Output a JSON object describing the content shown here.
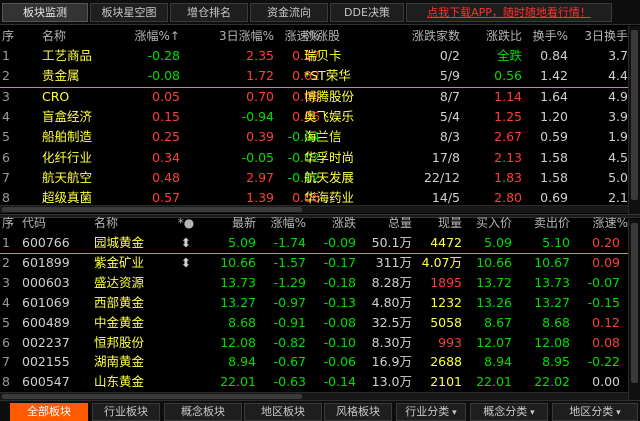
{
  "colors": {
    "up": "#ff3c3c",
    "down": "#00dd00",
    "yellow": "#ffff40",
    "cyan": "#40e0ff",
    "neutral": "#d0d0d0",
    "accent": "#ff5a00"
  },
  "top_tabs": [
    "板块监测",
    "板块星空图",
    "增仓排名",
    "资金流向",
    "DDE决策"
  ],
  "promo": "点我下载APP，随时随地看行情！",
  "upper": {
    "headers": [
      "序",
      "名称",
      "涨幅%↑",
      "3日涨幅%",
      "涨速%",
      "领涨股",
      "涨跌家数",
      "涨跌比",
      "换手%",
      "3日换手"
    ],
    "rows": [
      {
        "idx": "1",
        "name": "工艺商品",
        "chg": "-0.28",
        "chg3": "2.35",
        "speed": "0.17",
        "leader": "瑞贝卡",
        "updown": "0/2",
        "ratio": "全跌",
        "turn": "0.84",
        "turn3": "3.7"
      },
      {
        "idx": "2",
        "name": "贵金属",
        "chg": "-0.08",
        "chg3": "1.72",
        "speed": "0.02",
        "leader": "*ST荣华",
        "updown": "5/9",
        "ratio": "0.56",
        "turn": "1.42",
        "turn3": "4.4"
      },
      {
        "idx": "3",
        "name": "CRO",
        "chg": "0.05",
        "chg3": "0.70",
        "speed": "0.08",
        "leader": "博腾股份",
        "updown": "8/7",
        "ratio": "1.14",
        "turn": "1.64",
        "turn3": "4.9"
      },
      {
        "idx": "4",
        "name": "盲盒经济",
        "chg": "0.15",
        "chg3": "-0.94",
        "speed": "0.06",
        "leader": "奥飞娱乐",
        "updown": "5/4",
        "ratio": "1.25",
        "turn": "1.20",
        "turn3": "3.9"
      },
      {
        "idx": "5",
        "name": "船舶制造",
        "chg": "0.25",
        "chg3": "0.39",
        "speed": "-0.04",
        "leader": "海兰信",
        "updown": "8/3",
        "ratio": "2.67",
        "turn": "0.59",
        "turn3": "1.9"
      },
      {
        "idx": "6",
        "name": "化纤行业",
        "chg": "0.34",
        "chg3": "-0.05",
        "speed": "-0.02",
        "leader": "华孚时尚",
        "updown": "17/8",
        "ratio": "2.13",
        "turn": "1.58",
        "turn3": "4.5"
      },
      {
        "idx": "7",
        "name": "航天航空",
        "chg": "0.48",
        "chg3": "2.97",
        "speed": "-0.02",
        "leader": "航天发展",
        "updown": "22/12",
        "ratio": "1.83",
        "turn": "1.58",
        "turn3": "5.0"
      },
      {
        "idx": "8",
        "name": "超级真菌",
        "chg": "0.57",
        "chg3": "1.39",
        "speed": "0.06",
        "leader": "华海药业",
        "updown": "14/5",
        "ratio": "2.80",
        "turn": "0.69",
        "turn3": "2.1"
      }
    ]
  },
  "lower": {
    "headers": [
      "序",
      "代码",
      "名称",
      "*●",
      "最新",
      "涨幅%",
      "涨跌",
      "总量",
      "现量",
      "买入价",
      "卖出价",
      "涨速%"
    ],
    "rows": [
      {
        "idx": "1",
        "code": "600766",
        "name": "园城黄金",
        "mark": "⬍",
        "price": "5.09",
        "chg": "-1.74",
        "diff": "-0.09",
        "vol": "50.1万",
        "now": "4472",
        "buy": "5.09",
        "sell": "5.10",
        "speed": "0.20"
      },
      {
        "idx": "2",
        "code": "601899",
        "name": "紫金矿业",
        "mark": "⬍",
        "price": "10.66",
        "chg": "-1.57",
        "diff": "-0.17",
        "vol": "311万",
        "now": "4.07万",
        "buy": "10.66",
        "sell": "10.67",
        "speed": "0.09"
      },
      {
        "idx": "3",
        "code": "000603",
        "name": "盛达资源",
        "mark": "",
        "price": "13.73",
        "chg": "-1.29",
        "diff": "-0.18",
        "vol": "8.28万",
        "now": "1895",
        "buy": "13.72",
        "sell": "13.73",
        "speed": "-0.07"
      },
      {
        "idx": "4",
        "code": "601069",
        "name": "西部黄金",
        "mark": "",
        "price": "13.27",
        "chg": "-0.97",
        "diff": "-0.13",
        "vol": "4.80万",
        "now": "1232",
        "buy": "13.26",
        "sell": "13.27",
        "speed": "-0.15"
      },
      {
        "idx": "5",
        "code": "600489",
        "name": "中金黄金",
        "mark": "",
        "price": "8.68",
        "chg": "-0.91",
        "diff": "-0.08",
        "vol": "32.5万",
        "now": "5058",
        "buy": "8.67",
        "sell": "8.68",
        "speed": "0.12"
      },
      {
        "idx": "6",
        "code": "002237",
        "name": "恒邦股份",
        "mark": "",
        "price": "12.08",
        "chg": "-0.82",
        "diff": "-0.10",
        "vol": "8.30万",
        "now": "993",
        "buy": "12.07",
        "sell": "12.08",
        "speed": "0.08"
      },
      {
        "idx": "7",
        "code": "002155",
        "name": "湖南黄金",
        "mark": "",
        "price": "8.94",
        "chg": "-0.67",
        "diff": "-0.06",
        "vol": "16.9万",
        "now": "2688",
        "buy": "8.94",
        "sell": "8.95",
        "speed": "-0.22"
      },
      {
        "idx": "8",
        "code": "600547",
        "name": "山东黄金",
        "mark": "",
        "price": "22.01",
        "chg": "-0.63",
        "diff": "-0.14",
        "vol": "13.0万",
        "now": "2101",
        "buy": "22.01",
        "sell": "22.02",
        "speed": "0.00"
      }
    ]
  },
  "bottom_tabs": [
    {
      "label": "全部板块",
      "dropdown": false
    },
    {
      "label": "行业板块",
      "dropdown": false
    },
    {
      "label": "概念板块",
      "dropdown": false
    },
    {
      "label": "地区板块",
      "dropdown": false
    },
    {
      "label": "风格板块",
      "dropdown": false
    },
    {
      "label": "行业分类",
      "dropdown": true
    },
    {
      "label": "概念分类",
      "dropdown": true
    },
    {
      "label": "地区分类",
      "dropdown": true
    }
  ],
  "dropdown_glyph": "▾"
}
